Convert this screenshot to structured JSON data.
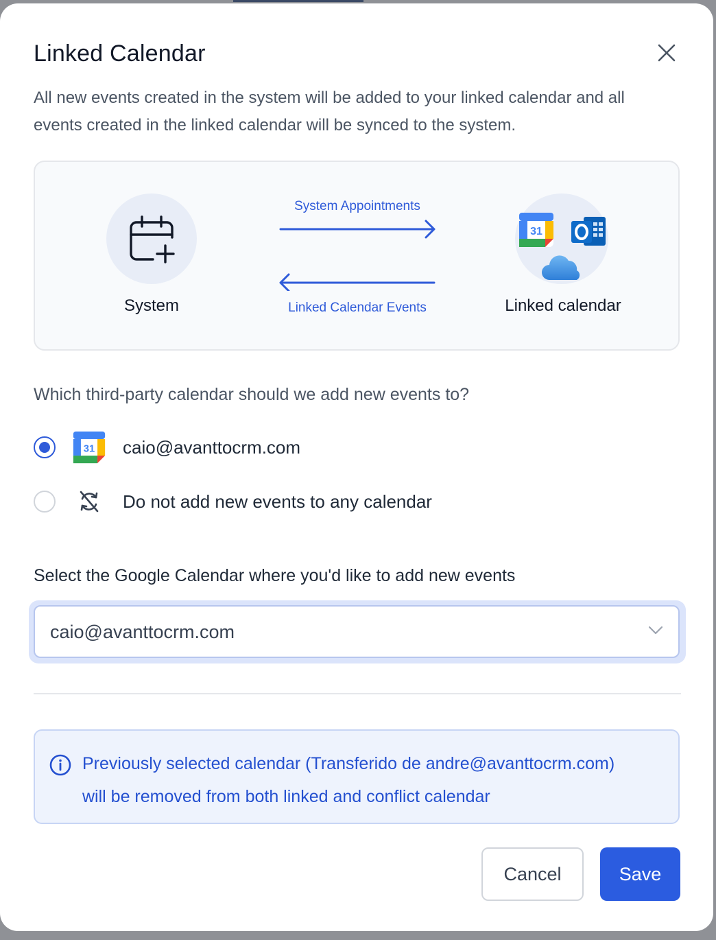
{
  "modal": {
    "title": "Linked Calendar",
    "description": "All new events created in the system will be added to your linked calendar and all events created in the linked calendar will be synced to the system.",
    "close_icon": "close-icon"
  },
  "diagram": {
    "system_label": "System",
    "linked_label": "Linked calendar",
    "arrow_right_label": "System Appointments",
    "arrow_left_label": "Linked Calendar Events",
    "icons": [
      "calendar-plus-icon",
      "google-calendar-icon",
      "outlook-icon",
      "icloud-icon"
    ],
    "accent_color": "#2f5bd9"
  },
  "question": "Which third-party calendar should we add new events to?",
  "options": [
    {
      "label": "caio@avanttocrm.com",
      "checked": true,
      "icon": "google-calendar-icon"
    },
    {
      "label": "Do not add new events to any calendar",
      "checked": false,
      "icon": "sync-off-icon"
    }
  ],
  "select": {
    "label": "Select the Google Calendar where you'd like to add new events",
    "value": "caio@avanttocrm.com",
    "icon": "chevron-down-icon"
  },
  "info": {
    "icon": "info-icon",
    "line1": "Previously selected calendar (Transferido de andre@avanttocrm.com)",
    "line2": "will be removed from both linked and conflict calendar"
  },
  "footer": {
    "cancel_label": "Cancel",
    "save_label": "Save",
    "primary_color": "#2b5ce0"
  }
}
